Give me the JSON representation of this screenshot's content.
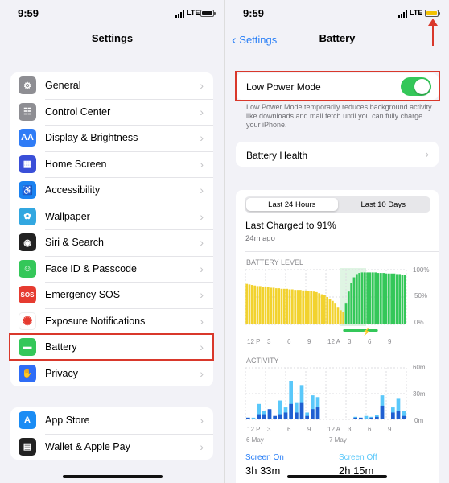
{
  "left": {
    "status": {
      "time": "9:59",
      "network": "LTE",
      "battery_color": "#111111"
    },
    "nav": {
      "title": "Settings"
    },
    "group1": [
      {
        "label": "General",
        "icon": "gear-icon",
        "color": "#8e8e93",
        "glyph": "⚙"
      },
      {
        "label": "Control Center",
        "icon": "control-center-icon",
        "color": "#8e8e93",
        "glyph": "☷"
      },
      {
        "label": "Display & Brightness",
        "icon": "display-icon",
        "color": "#2f7cf6",
        "glyph": "AA"
      },
      {
        "label": "Home Screen",
        "icon": "home-screen-icon",
        "color": "#3a4fd8",
        "glyph": "▦"
      },
      {
        "label": "Accessibility",
        "icon": "accessibility-icon",
        "color": "#1b82f0",
        "glyph": "♿"
      },
      {
        "label": "Wallpaper",
        "icon": "wallpaper-icon",
        "color": "#32a7e0",
        "glyph": "✿"
      },
      {
        "label": "Siri & Search",
        "icon": "siri-icon",
        "color": "#222222",
        "glyph": "◉"
      },
      {
        "label": "Face ID & Passcode",
        "icon": "face-id-icon",
        "color": "#34c759",
        "glyph": "☺"
      },
      {
        "label": "Emergency SOS",
        "icon": "sos-icon",
        "color": "#e63b30",
        "glyph": "SOS"
      },
      {
        "label": "Exposure Notifications",
        "icon": "exposure-icon",
        "color": "#ffffff",
        "glyph": "✺"
      },
      {
        "label": "Battery",
        "icon": "battery-icon",
        "color": "#34c759",
        "glyph": "▬"
      },
      {
        "label": "Privacy",
        "icon": "hand-icon",
        "color": "#2f6df6",
        "glyph": "✋"
      }
    ],
    "group2": [
      {
        "label": "App Store",
        "icon": "app-store-icon",
        "color": "#1a8cf4",
        "glyph": "A"
      },
      {
        "label": "Wallet & Apple Pay",
        "icon": "wallet-icon",
        "color": "#222222",
        "glyph": "▤"
      }
    ]
  },
  "right": {
    "status": {
      "time": "9:59",
      "network": "LTE",
      "battery_color": "#f3c200"
    },
    "nav": {
      "back_label": "Settings",
      "title": "Battery"
    },
    "low_power": {
      "label": "Low Power Mode",
      "enabled": true,
      "note": "Low Power Mode temporarily reduces background activity like downloads and mail fetch until you can fully charge your iPhone."
    },
    "battery_health": {
      "label": "Battery Health"
    },
    "segments": {
      "tab1": "Last 24 Hours",
      "tab2": "Last 10 Days",
      "selected": "Last 24 Hours"
    },
    "last_charged": {
      "title": "Last Charged to 91%",
      "ago": "24m ago"
    },
    "screen_on": {
      "label": "Screen On",
      "value": "3h 33m"
    },
    "screen_off": {
      "label": "Screen Off",
      "value": "2h 15m"
    },
    "colors": {
      "accent": "#2a7ff6",
      "highlight": "#d9382b",
      "battery_yellow": "#f2d22e",
      "battery_green": "#34c759",
      "activity_dark": "#1f5fd1",
      "activity_light": "#5ac8fa"
    }
  },
  "chart_data": [
    {
      "type": "bar",
      "title": "BATTERY LEVEL",
      "y_ticks": [
        "100%",
        "50%",
        "0%"
      ],
      "ylim": [
        0,
        100
      ],
      "x_ticks": [
        "12 P",
        "3",
        "6",
        "9",
        "12 A",
        "3",
        "6",
        "9"
      ],
      "series": [
        {
          "values": [
            74,
            73,
            72,
            71,
            70,
            70,
            69,
            68,
            68,
            67,
            67,
            66,
            66,
            65,
            65,
            65,
            64,
            64,
            63,
            63,
            63,
            62,
            62,
            61,
            61,
            60,
            59,
            57,
            55,
            53,
            50,
            47,
            43,
            38,
            32,
            26,
            23,
            38,
            60,
            76,
            86,
            92,
            94,
            95,
            95,
            95,
            95,
            95,
            95,
            94,
            94,
            94,
            93,
            93,
            93,
            93,
            92,
            92,
            91,
            91
          ]
        }
      ],
      "charging_start_index": 37,
      "charging_end_index": 44
    },
    {
      "type": "bar",
      "title": "ACTIVITY",
      "y_ticks": [
        "60m",
        "30m",
        "0m"
      ],
      "ylim": [
        0,
        60
      ],
      "x_ticks": [
        "12 P",
        "3",
        "6",
        "9",
        "12 A",
        "3",
        "6",
        "9"
      ],
      "dates": [
        "6 May",
        "7 May"
      ],
      "series": [
        {
          "name": "Screen On",
          "values": [
            2,
            2,
            18,
            10,
            11,
            3,
            22,
            14,
            45,
            20,
            40,
            8,
            28,
            26,
            0,
            0,
            0,
            0,
            0,
            0,
            3,
            2,
            4,
            3,
            5,
            28,
            0,
            14,
            24,
            10
          ]
        },
        {
          "name": "Screen Off",
          "values": [
            2,
            1,
            6,
            6,
            12,
            4,
            6,
            8,
            18,
            8,
            20,
            4,
            12,
            14,
            0,
            0,
            0,
            0,
            0,
            0,
            2,
            2,
            1,
            2,
            3,
            16,
            0,
            8,
            10,
            4
          ]
        }
      ]
    }
  ]
}
